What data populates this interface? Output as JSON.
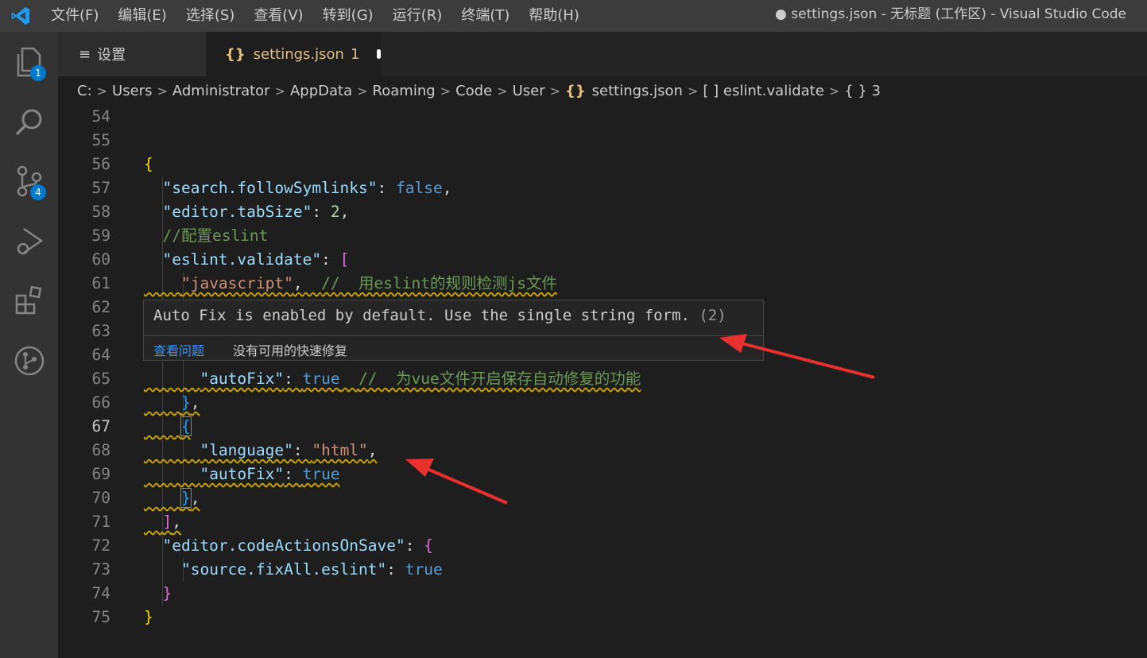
{
  "titlebar": {
    "menu": [
      "文件(F)",
      "编辑(E)",
      "选择(S)",
      "查看(V)",
      "转到(G)",
      "运行(R)",
      "终端(T)",
      "帮助(H)"
    ],
    "window_title": "● settings.json - 无标题 (工作区) - Visual Studio Code"
  },
  "activity": {
    "explorer_badge": "1",
    "scm_badge": "4"
  },
  "tabs": {
    "settings": "设置",
    "settings_json": "settings.json",
    "problem_count": "1"
  },
  "breadcrumb": {
    "drive": "C:",
    "items": [
      "Users",
      "Administrator",
      "AppData",
      "Roaming",
      "Code",
      "User"
    ],
    "file": "settings.json",
    "symbol_array": "[ ] eslint.validate",
    "symbol_obj": "{ } 3"
  },
  "editor": {
    "line_numbers": [
      "54",
      "55",
      "56",
      "57",
      "58",
      "59",
      "60",
      "61",
      "62",
      "63",
      "64",
      "65",
      "66",
      "67",
      "68",
      "69",
      "70",
      "71",
      "72",
      "73",
      "74",
      "75"
    ],
    "active_line": "67",
    "lines": {
      "l57_key": "\"search.followSymlinks\"",
      "l57_val": "false",
      "l58_key": "\"editor.tabSize\"",
      "l58_val": "2",
      "l59_cmt": "//配置eslint",
      "l60_key": "\"eslint.validate\"",
      "l61_str": "\"javascript\"",
      "l61_cmt": "//  用eslint的规则检测js文件",
      "l65_key": "\"autoFix\"",
      "l65_val": "true",
      "l65_cmt": "//  为vue文件开启保存自动修复的功能",
      "l68_key": "\"language\"",
      "l68_str": "\"html\"",
      "l69_key": "\"autoFix\"",
      "l69_val": "true",
      "l72_key": "\"editor.codeActionsOnSave\"",
      "l73_key": "\"source.fixAll.eslint\"",
      "l73_val": "true"
    }
  },
  "hover": {
    "message": "Auto Fix is enabled by default. Use the single string form.",
    "count": "(2)",
    "view_problem": "查看问题",
    "no_fix": "没有可用的快速修复"
  },
  "colors": {
    "annotation_arrow": "#e8312f",
    "accent": "#007acc"
  }
}
